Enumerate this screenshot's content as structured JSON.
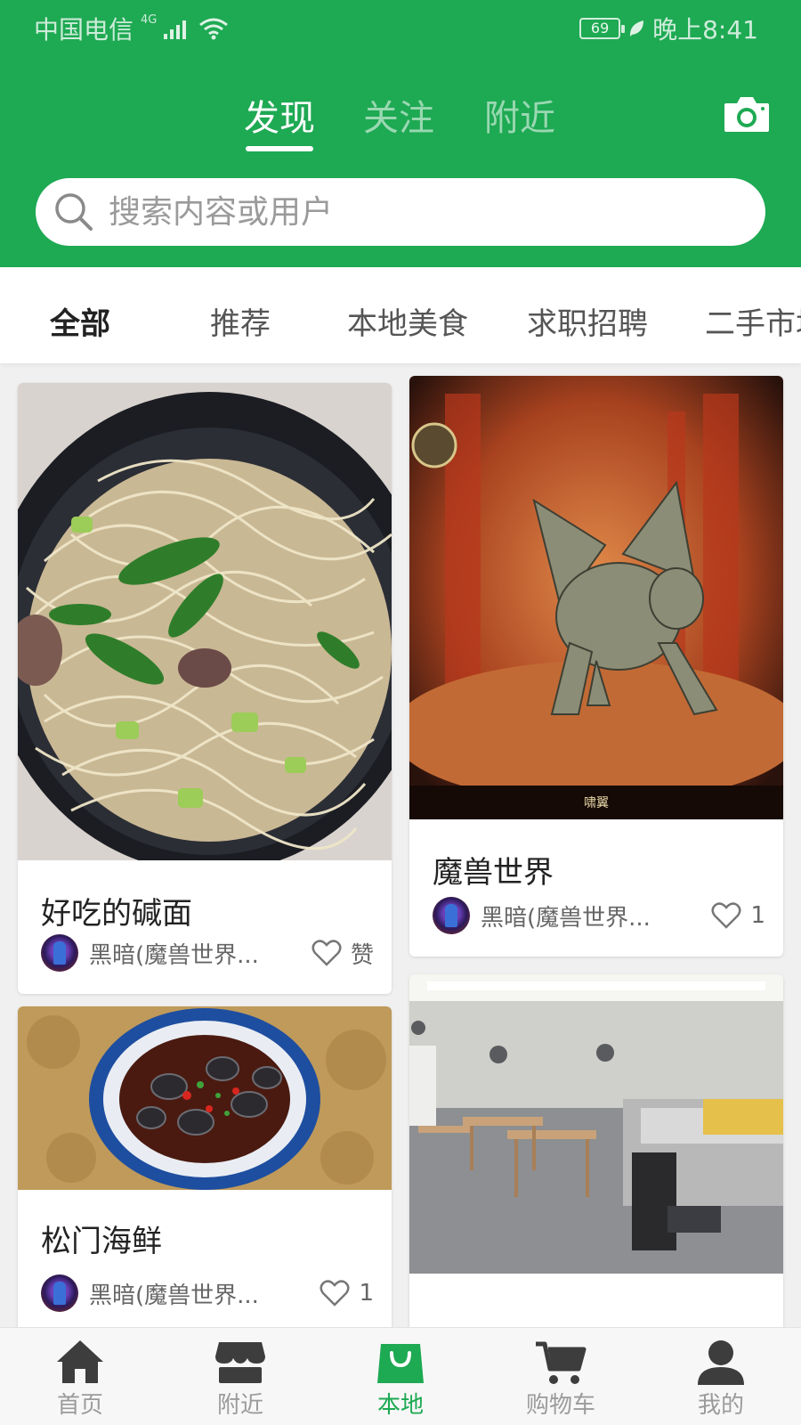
{
  "status_bar": {
    "carrier": "中国电信",
    "network": "4G",
    "battery": "69",
    "time": "晚上8:41"
  },
  "top_tabs": [
    {
      "label": "发现",
      "active": true
    },
    {
      "label": "关注",
      "active": false
    },
    {
      "label": "附近",
      "active": false
    }
  ],
  "search": {
    "placeholder": "搜索内容或用户"
  },
  "categories": [
    {
      "label": "全部",
      "active": true
    },
    {
      "label": "推荐",
      "active": false
    },
    {
      "label": "本地美食",
      "active": false
    },
    {
      "label": "求职招聘",
      "active": false
    },
    {
      "label": "二手市场",
      "active": false
    }
  ],
  "posts": [
    {
      "title": "好吃的碱面",
      "author": "黑暗(魔兽世界...",
      "likes": "赞",
      "image": "noodle-bowl"
    },
    {
      "title": "魔兽世界",
      "author": "黑暗(魔兽世界...",
      "likes": "1",
      "image": "dragon-art",
      "image_caption": "啸翼"
    },
    {
      "title": "松门海鲜",
      "author": "黑暗(魔兽世界...",
      "likes": "1",
      "image": "seafood-plate"
    },
    {
      "image": "restaurant-interior"
    }
  ],
  "bottom_nav": [
    {
      "label": "首页",
      "icon": "home-icon",
      "active": false
    },
    {
      "label": "附近",
      "icon": "store-icon",
      "active": false
    },
    {
      "label": "本地",
      "icon": "shopping-bag-icon",
      "active": true
    },
    {
      "label": "购物车",
      "icon": "cart-icon",
      "active": false
    },
    {
      "label": "我的",
      "icon": "user-icon",
      "active": false
    }
  ],
  "colors": {
    "brand_green": "#1ea953",
    "text_dark": "#222222",
    "text_muted": "#666666",
    "nav_inactive": "#9b9b9b"
  }
}
